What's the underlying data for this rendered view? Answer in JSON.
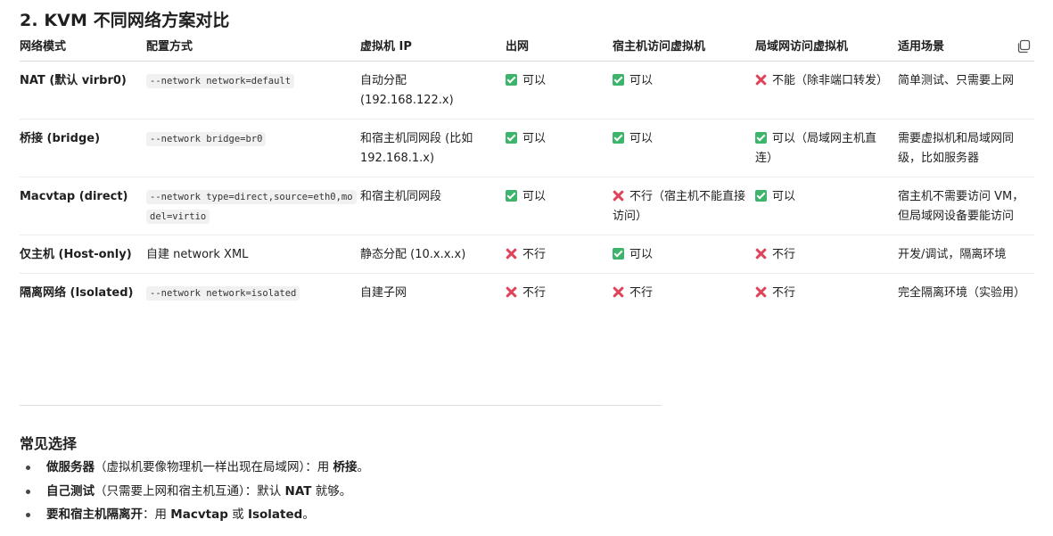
{
  "section_title": "2. KVM 不同网络方案对比",
  "table": {
    "headers": [
      "网络模式",
      "配置方式",
      "虚拟机 IP",
      "出网",
      "宿主机访问虚拟机",
      "局域网访问虚拟机",
      "适用场景"
    ],
    "rows": [
      {
        "mode": "NAT (默认 virbr0)",
        "config": "--network network=default",
        "ip": "自动分配 (192.168.122.x)",
        "out": "可以",
        "host": "可以",
        "lan": "不能（除非端口转发）",
        "scene": "简单测试、只需要上网"
      },
      {
        "mode": "桥接 (bridge)",
        "config": "--network bridge=br0",
        "ip": "和宿主机同网段 (比如 192.168.1.x)",
        "out": "可以",
        "host": "可以",
        "lan": "可以（局域网主机直连）",
        "scene": "需要虚拟机和局域网同级，比如服务器"
      },
      {
        "mode": "Macvtap (direct)",
        "config": "--network type=direct,source=eth0,model=virtio",
        "ip": "和宿主机同网段",
        "out": "可以",
        "host": "不行（宿主机不能直接访问）",
        "lan": "可以",
        "scene": "宿主机不需要访问 VM，但局域网设备要能访问"
      },
      {
        "mode": "仅主机 (Host-only)",
        "config": "自建 network XML",
        "ip": "静态分配 (10.x.x.x)",
        "out": "不行",
        "host": "可以",
        "lan": "不行",
        "scene": "开发/调试，隔离环境"
      },
      {
        "mode": "隔离网络 (Isolated)",
        "config": "--network network=isolated",
        "ip": "自建子网",
        "out": "不行",
        "host": "不行",
        "lan": "不行",
        "scene": "完全隔离环境（实验用）"
      }
    ]
  },
  "common": {
    "title": "常见选择",
    "items": [
      {
        "lead": "做服务器",
        "mid": "（虚拟机要像物理机一样出现在局域网）：用 ",
        "strong": "桥接",
        "tail": "。"
      },
      {
        "lead": "自己测试",
        "mid": "（只需要上网和宿主机互通）：默认 ",
        "strong": "NAT",
        "tail": " 就够。"
      },
      {
        "lead": "要和宿主机隔离开",
        "mid": "：用 ",
        "strong": "Macvtap",
        "mid2": " 或 ",
        "strong2": "Isolated",
        "tail": "。"
      }
    ]
  },
  "colors": {
    "yes": "#3db36b",
    "no": "#e0445a"
  },
  "icons": {
    "yes": "check-icon",
    "no": "cross-icon",
    "copy": "copy-icon"
  }
}
